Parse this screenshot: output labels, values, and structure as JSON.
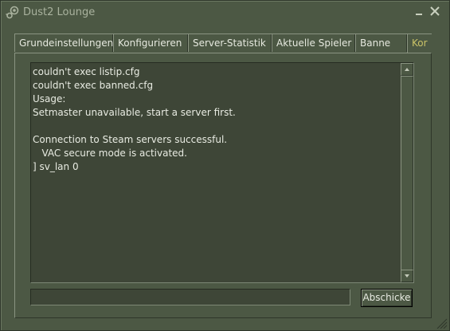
{
  "window": {
    "title": "Dust2 Lounge",
    "minimize_icon": "minimize-icon",
    "close_icon": "close-icon"
  },
  "tabs": [
    {
      "label": "Grundeinstellungen",
      "active": false
    },
    {
      "label": "Konfigurieren",
      "active": false
    },
    {
      "label": "Server-Statistik",
      "active": false
    },
    {
      "label": "Aktuelle Spieler",
      "active": false
    },
    {
      "label": "Banne",
      "active": false
    },
    {
      "label": "Kor",
      "active": true
    }
  ],
  "console": {
    "lines": [
      "couldn't exec listip.cfg",
      "couldn't exec banned.cfg",
      "Usage:",
      "Setmaster unavailable, start a server first.",
      "",
      "Connection to Steam servers successful.",
      "   VAC secure mode is activated.",
      "] sv_lan 0"
    ]
  },
  "command": {
    "value": "",
    "submit_label": "Abschicke"
  },
  "colors": {
    "background": "#4c5844",
    "console_bg": "#3e4637",
    "active_tab_text": "#c9c267"
  }
}
